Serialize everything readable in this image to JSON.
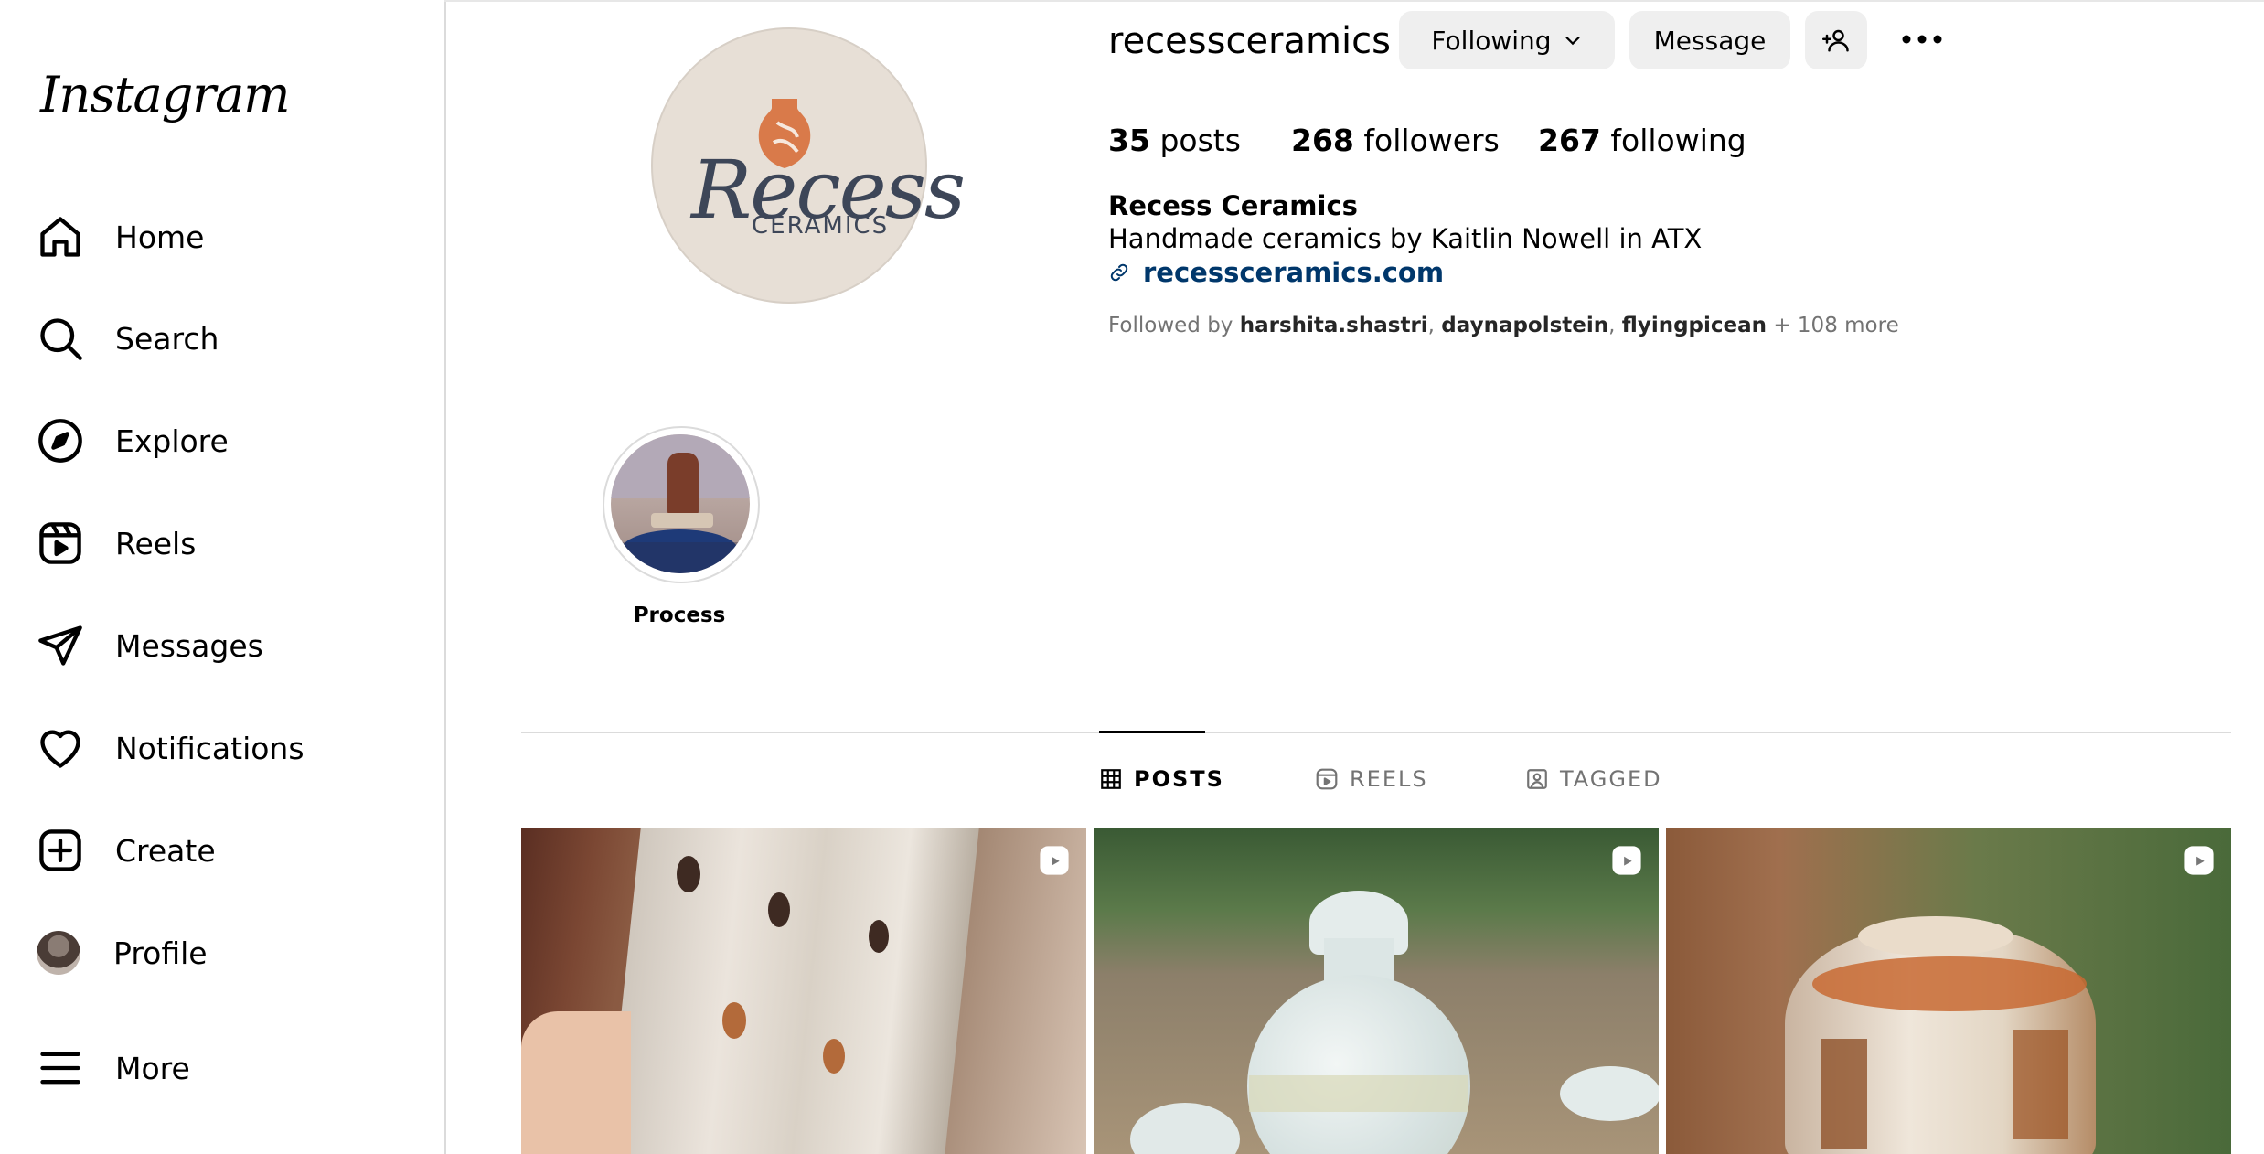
{
  "app": {
    "logo_text": "Instagram"
  },
  "sidebar": {
    "items": [
      {
        "label": "Home",
        "icon": "home-icon"
      },
      {
        "label": "Search",
        "icon": "search-icon"
      },
      {
        "label": "Explore",
        "icon": "compass-icon"
      },
      {
        "label": "Reels",
        "icon": "reels-icon"
      },
      {
        "label": "Messages",
        "icon": "paper-plane-icon"
      },
      {
        "label": "Notifications",
        "icon": "heart-icon"
      },
      {
        "label": "Create",
        "icon": "plus-square-icon"
      },
      {
        "label": "Profile",
        "icon": "avatar"
      },
      {
        "label": "More",
        "icon": "hamburger-icon"
      }
    ]
  },
  "profile": {
    "username": "recessceramics",
    "avatar_text": "Recess",
    "avatar_subtext": "CERAMICS",
    "following_button": "Following",
    "message_button": "Message",
    "stats": {
      "posts_count": "35",
      "posts_label": "posts",
      "followers_count": "268",
      "followers_label": "followers",
      "following_count": "267",
      "following_label": "following"
    },
    "bio": {
      "name": "Recess Ceramics",
      "text": "Handmade ceramics by Kaitlin Nowell in ATX",
      "link": "recessceramics.com"
    },
    "followed_by": {
      "prefix": "Followed by",
      "user1": "harshita.shastri",
      "user2": "daynapolstein",
      "user3": "flyingpicean",
      "more": "+ 108 more"
    }
  },
  "highlights": [
    {
      "label": "Process"
    }
  ],
  "tabs": [
    {
      "label": "POSTS",
      "active": true
    },
    {
      "label": "REELS",
      "active": false
    },
    {
      "label": "TAGGED",
      "active": false
    }
  ],
  "colors": {
    "button_bg": "#efefef",
    "link": "#00376b",
    "border": "#dbdbdb",
    "avatar_bg": "#e7dfd6"
  }
}
